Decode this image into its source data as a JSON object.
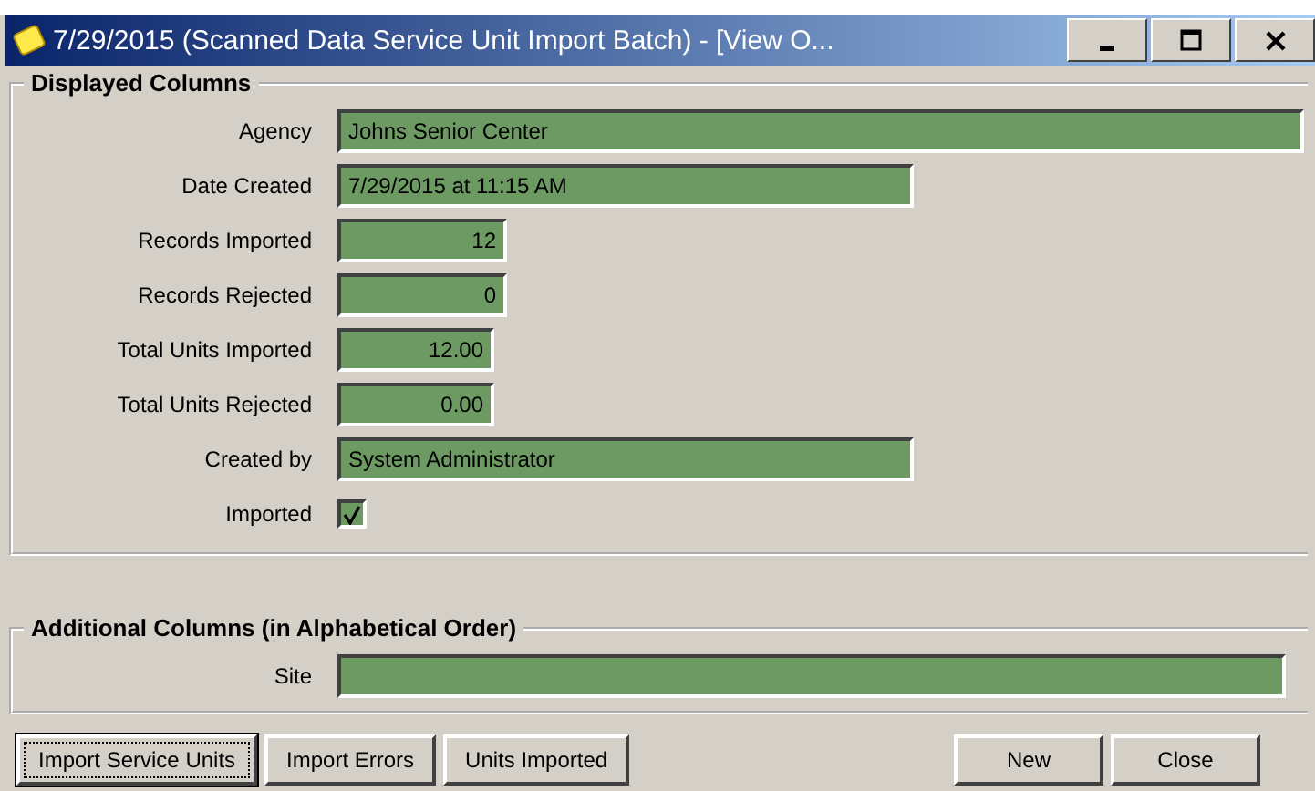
{
  "window": {
    "title": "7/29/2015 (Scanned Data Service Unit Import Batch) - [View O..."
  },
  "displayed_columns": {
    "title": "Displayed Columns",
    "fields": [
      {
        "kind": "text",
        "label": "Agency",
        "value": "Johns Senior Center"
      },
      {
        "kind": "text",
        "label": "Date Created",
        "value": "7/29/2015 at 11:15 AM"
      },
      {
        "kind": "number",
        "label": "Records Imported",
        "value": "12"
      },
      {
        "kind": "number",
        "label": "Records Rejected",
        "value": "0"
      },
      {
        "kind": "number",
        "label": "Total Units Imported",
        "value": "12.00"
      },
      {
        "kind": "number",
        "label": "Total Units Rejected",
        "value": "0.00"
      },
      {
        "kind": "text",
        "label": "Created by",
        "value": "System Administrator"
      },
      {
        "kind": "checkbox",
        "label": "Imported",
        "checked": true
      }
    ]
  },
  "additional_columns": {
    "title": "Additional Columns (in Alphabetical Order)",
    "fields": [
      {
        "kind": "text",
        "label": "Site"
      }
    ]
  },
  "buttons": [
    {
      "label": "Import Service Units",
      "focused": true
    },
    {
      "label": "Import Errors",
      "focused": false
    },
    {
      "label": "Units Imported",
      "focused": false
    },
    {
      "label": "New",
      "focused": false
    },
    {
      "label": "Close",
      "focused": false
    }
  ]
}
